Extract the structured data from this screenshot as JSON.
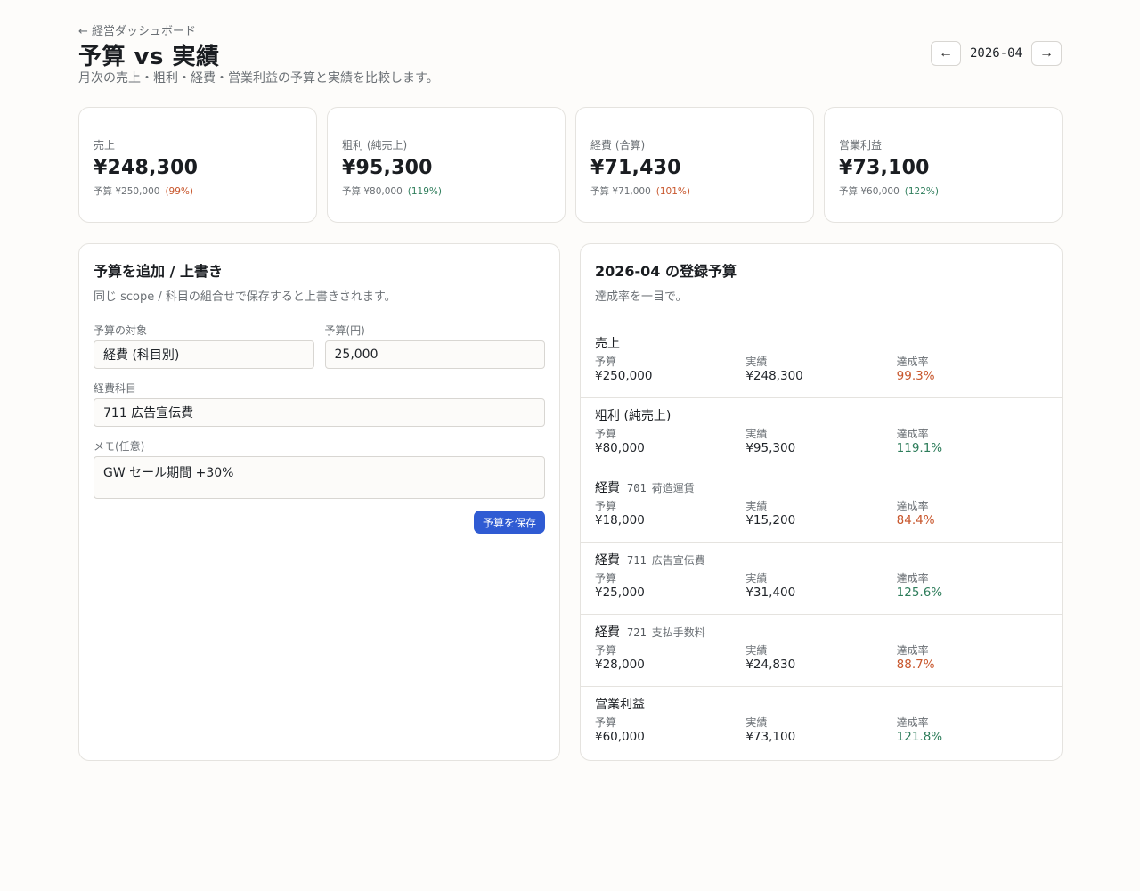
{
  "header": {
    "back_label": "← 経営ダッシュボード",
    "title": "予算 vs 実績",
    "subtitle": "月次の売上・粗利・経費・営業利益の予算と実績を比較します。"
  },
  "month_nav": {
    "prev_icon": "←",
    "month": "2026-04",
    "next_icon": "→"
  },
  "kpis": [
    {
      "label": "売上",
      "value": "¥248,300",
      "budget": "予算 ¥250,000",
      "pct": "(99%)",
      "status": "under"
    },
    {
      "label": "粗利 (純売上)",
      "value": "¥95,300",
      "budget": "予算 ¥80,000",
      "pct": "(119%)",
      "status": "over"
    },
    {
      "label": "経費 (合算)",
      "value": "¥71,430",
      "budget": "予算 ¥71,000",
      "pct": "(101%)",
      "status": "under"
    },
    {
      "label": "営業利益",
      "value": "¥73,100",
      "budget": "予算 ¥60,000",
      "pct": "(122%)",
      "status": "over"
    }
  ],
  "form": {
    "title": "予算を追加 / 上書き",
    "description": "同じ scope / 科目の組合せで保存すると上書きされます。",
    "target_label": "予算の対象",
    "target_value": "経費 (科目別)",
    "amount_label": "予算(円)",
    "amount_value": "25,000",
    "account_label": "経費科目",
    "account_value": "711 広告宣伝費",
    "memo_label": "メモ(任意)",
    "memo_value": "GW セール期間 +30%",
    "save_label": "予算を保存"
  },
  "budget_list": {
    "title": "2026-04 の登録予算",
    "description": "達成率を一目で。",
    "budget_label": "予算",
    "actual_label": "実績",
    "rate_label": "達成率",
    "rows": [
      {
        "title": "売上",
        "code": "",
        "account": "",
        "budget": "¥250,000",
        "actual": "¥248,300",
        "rate": "99.3%",
        "status": "under"
      },
      {
        "title": "粗利 (純売上)",
        "code": "",
        "account": "",
        "budget": "¥80,000",
        "actual": "¥95,300",
        "rate": "119.1%",
        "status": "over"
      },
      {
        "title": "経費",
        "code": "701",
        "account": "荷造運賃",
        "budget": "¥18,000",
        "actual": "¥15,200",
        "rate": "84.4%",
        "status": "under"
      },
      {
        "title": "経費",
        "code": "711",
        "account": "広告宣伝費",
        "budget": "¥25,000",
        "actual": "¥31,400",
        "rate": "125.6%",
        "status": "over"
      },
      {
        "title": "経費",
        "code": "721",
        "account": "支払手数料",
        "budget": "¥28,000",
        "actual": "¥24,830",
        "rate": "88.7%",
        "status": "under"
      },
      {
        "title": "営業利益",
        "code": "",
        "account": "",
        "budget": "¥60,000",
        "actual": "¥73,100",
        "rate": "121.8%",
        "status": "over"
      }
    ]
  },
  "colors": {
    "under": "#c8572d",
    "over": "#2e7d5b",
    "primary": "#2f5bd3"
  }
}
